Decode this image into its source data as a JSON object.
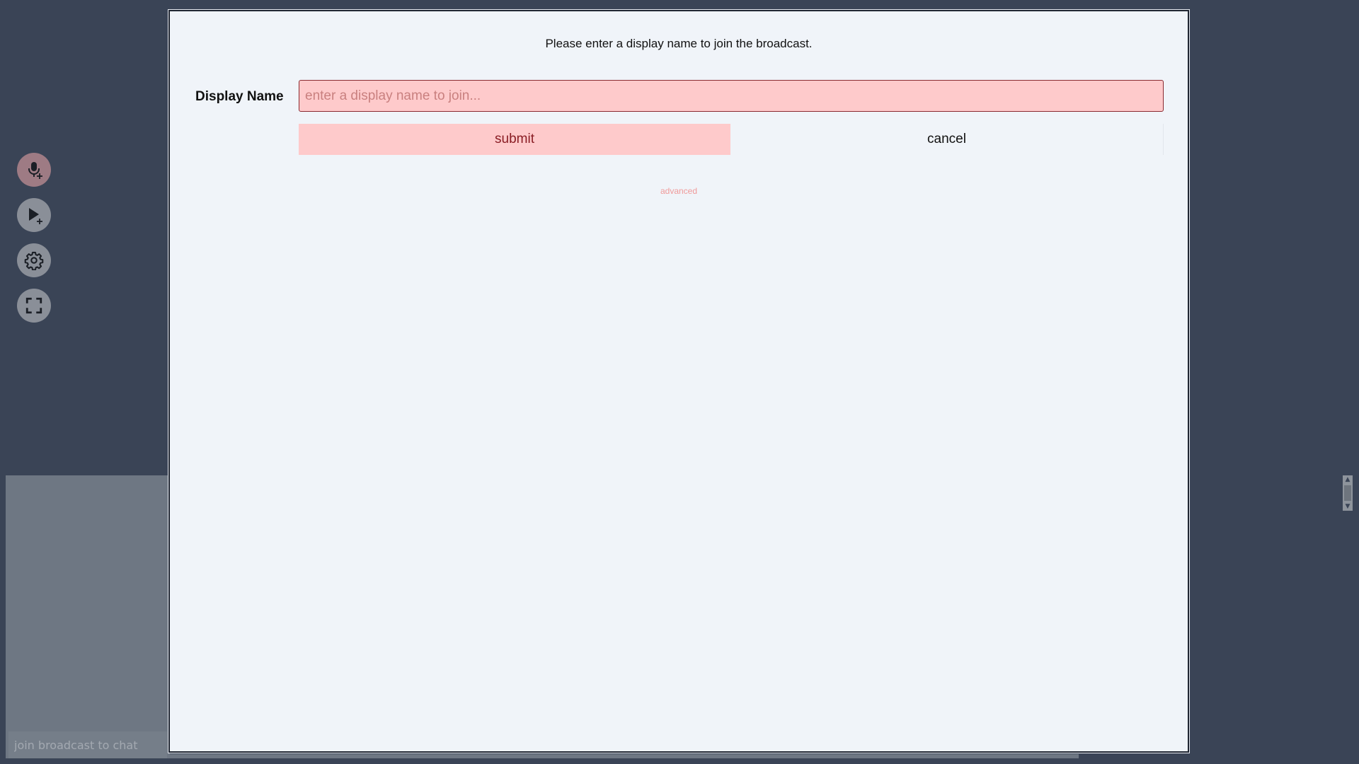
{
  "sidebar": {
    "buttons": [
      {
        "name": "mic-add-icon"
      },
      {
        "name": "play-add-icon"
      },
      {
        "name": "gear-icon"
      },
      {
        "name": "fullscreen-icon"
      }
    ]
  },
  "chat": {
    "placeholder": "join broadcast to chat"
  },
  "modal": {
    "message": "Please enter a display name to join the broadcast.",
    "field_label": "Display Name",
    "input_placeholder": "enter a display name to join...",
    "input_value": "",
    "submit_label": "submit",
    "cancel_label": "cancel",
    "advanced_label": "advanced"
  },
  "colors": {
    "background": "#3a4456",
    "modal_background": "#f0f4f9",
    "accent_pink": "#fecacb",
    "accent_text": "#8a1d24",
    "advanced_link": "#f09a9a"
  }
}
